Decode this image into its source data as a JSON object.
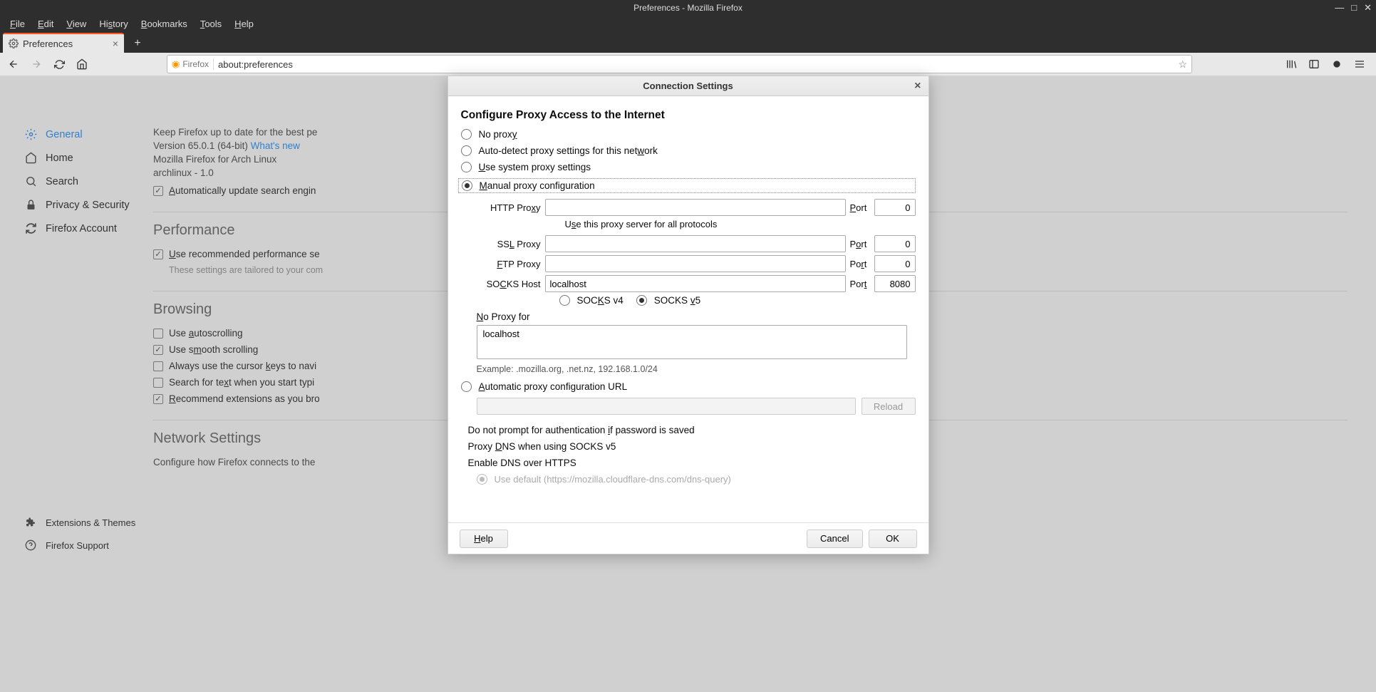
{
  "window": {
    "title": "Preferences - Mozilla Firefox"
  },
  "menubar": {
    "file": "File",
    "edit": "Edit",
    "view": "View",
    "history": "History",
    "bookmarks": "Bookmarks",
    "tools": "Tools",
    "help": "Help"
  },
  "tab": {
    "title": "Preferences"
  },
  "urlbar": {
    "identity": "Firefox",
    "url": "about:preferences"
  },
  "sidebar": {
    "general": "General",
    "home": "Home",
    "search": "Search",
    "privacy": "Privacy & Security",
    "account": "Firefox Account",
    "extensions": "Extensions & Themes",
    "support": "Firefox Support"
  },
  "prefs": {
    "update_line": "Keep Firefox up to date for the best pe",
    "version": "Version 65.0.1 (64-bit) ",
    "whatsnew": "What's new",
    "distro1": "Mozilla Firefox for Arch Linux",
    "distro2": "archlinux - 1.0",
    "auto_update_search": "Automatically update search engin",
    "performance_h": "Performance",
    "use_recommended": "Use recommended performance se",
    "perf_hint": "These settings are tailored to your com",
    "browsing_h": "Browsing",
    "autoscroll": "Use autoscrolling",
    "smooth": "Use smooth scrolling",
    "cursor": "Always use the cursor keys to navi",
    "searchtyping": "Search for text when you start typi",
    "recommend": "Recommend extensions as you bro",
    "network_h": "Network Settings",
    "network_desc": "Configure how Firefox connects to the"
  },
  "dialog": {
    "title": "Connection Settings",
    "heading": "Configure Proxy Access to the Internet",
    "no_proxy": "No proxy",
    "auto_detect": "Auto-detect proxy settings for this network",
    "use_system": "Use system proxy settings",
    "manual": "Manual proxy configuration",
    "http_proxy_label": "HTTP Proxy",
    "http_proxy_value": "",
    "http_port": "0",
    "use_for_all": "Use this proxy server for all protocols",
    "ssl_label": "SSL Proxy",
    "ssl_value": "",
    "ssl_port": "0",
    "ftp_label": "FTP Proxy",
    "ftp_value": "",
    "ftp_port": "0",
    "socks_label": "SOCKS Host",
    "socks_value": "localhost",
    "socks_port": "8080",
    "port_label": "Port",
    "socks_v4": "SOCKS v4",
    "socks_v5": "SOCKS v5",
    "noproxy_label": "No Proxy for",
    "noproxy_value": "localhost",
    "example": "Example: .mozilla.org, .net.nz, 192.168.1.0/24",
    "pac_label": "Automatic proxy configuration URL",
    "reload": "Reload",
    "no_prompt": "Do not prompt for authentication if password is saved",
    "proxy_dns": "Proxy DNS when using SOCKS v5",
    "enable_doh": "Enable DNS over HTTPS",
    "doh_default": "Use default (https://mozilla.cloudflare-dns.com/dns-query)",
    "help": "Help",
    "cancel": "Cancel",
    "ok": "OK"
  }
}
